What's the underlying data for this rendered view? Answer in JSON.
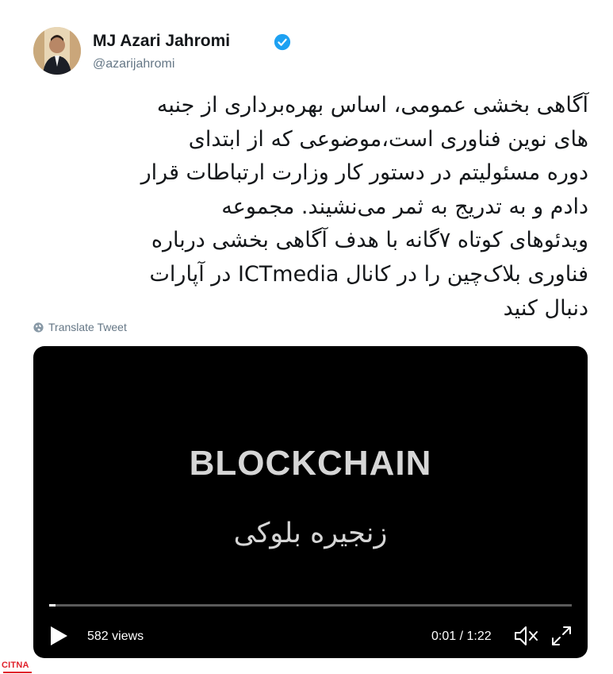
{
  "author": {
    "name": "MJ Azari Jahromi",
    "handle": "@azarijahromi",
    "verified": true
  },
  "tweet": {
    "text": "آگاهی بخشی عمومی، اساس بهره‌برداری از جنبه\nهای نوین فناوری است،موضوعی که از ابتدای\nدوره مسئولیتم در دستور کار وزارت ارتباطات قرار\nدادم و به تدریج به ثمر می‌نشیند. مجموعه\nویدئوهای کوتاه ۷گانه با هدف آگاهی بخشی درباره\nفناوری بلاک‌چین را در کانال ICTmedia در آپارات\nدنبال کنید",
    "translate_label": "Translate Tweet"
  },
  "video": {
    "title_en": "BLOCKCHAIN",
    "title_fa": "زنجیره بلوکی",
    "views": "582 views",
    "time": "0:01 / 1:22",
    "progress": 0.012
  },
  "watermark": {
    "text": "CITNA"
  },
  "colors": {
    "text": "#14171a",
    "secondary": "#657786",
    "verified": "#1da1f2",
    "video_bg": "#000000",
    "watermark": "#e0202a"
  }
}
